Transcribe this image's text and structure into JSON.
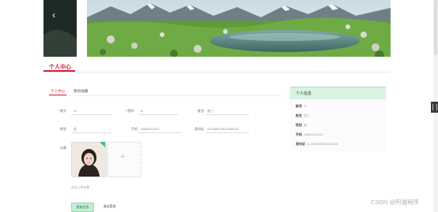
{
  "banner": {
    "prev_arrow": "‹"
  },
  "page": {
    "title": "个人中心"
  },
  "tabs": [
    {
      "label": "个人中心"
    },
    {
      "label": "我的收藏"
    }
  ],
  "form": {
    "account": {
      "label": "* 账号",
      "value": "11"
    },
    "password": {
      "label": "* 密码",
      "value": "11"
    },
    "name": {
      "label": "姓名",
      "value": "张三"
    },
    "gender": {
      "label": "性别",
      "value": "女"
    },
    "phone": {
      "label": "手机",
      "value": "13823222222"
    },
    "id_card": {
      "label": "身份证",
      "value": "412345678912345222"
    },
    "avatar": {
      "label": "头像"
    },
    "upload_hint": "点击上传头像"
  },
  "buttons": {
    "update": "更新信息",
    "logout": "退出登录"
  },
  "info_panel": {
    "title": "个人信息",
    "rows": [
      {
        "key": "账号",
        "value": "11"
      },
      {
        "key": "姓名",
        "value": "张三"
      },
      {
        "key": "性别",
        "value": "女"
      },
      {
        "key": "手机",
        "value": "13823222222"
      },
      {
        "key": "身份证",
        "value": "412345678912345222"
      }
    ]
  },
  "watermark": "CSDN @阿诚程序"
}
